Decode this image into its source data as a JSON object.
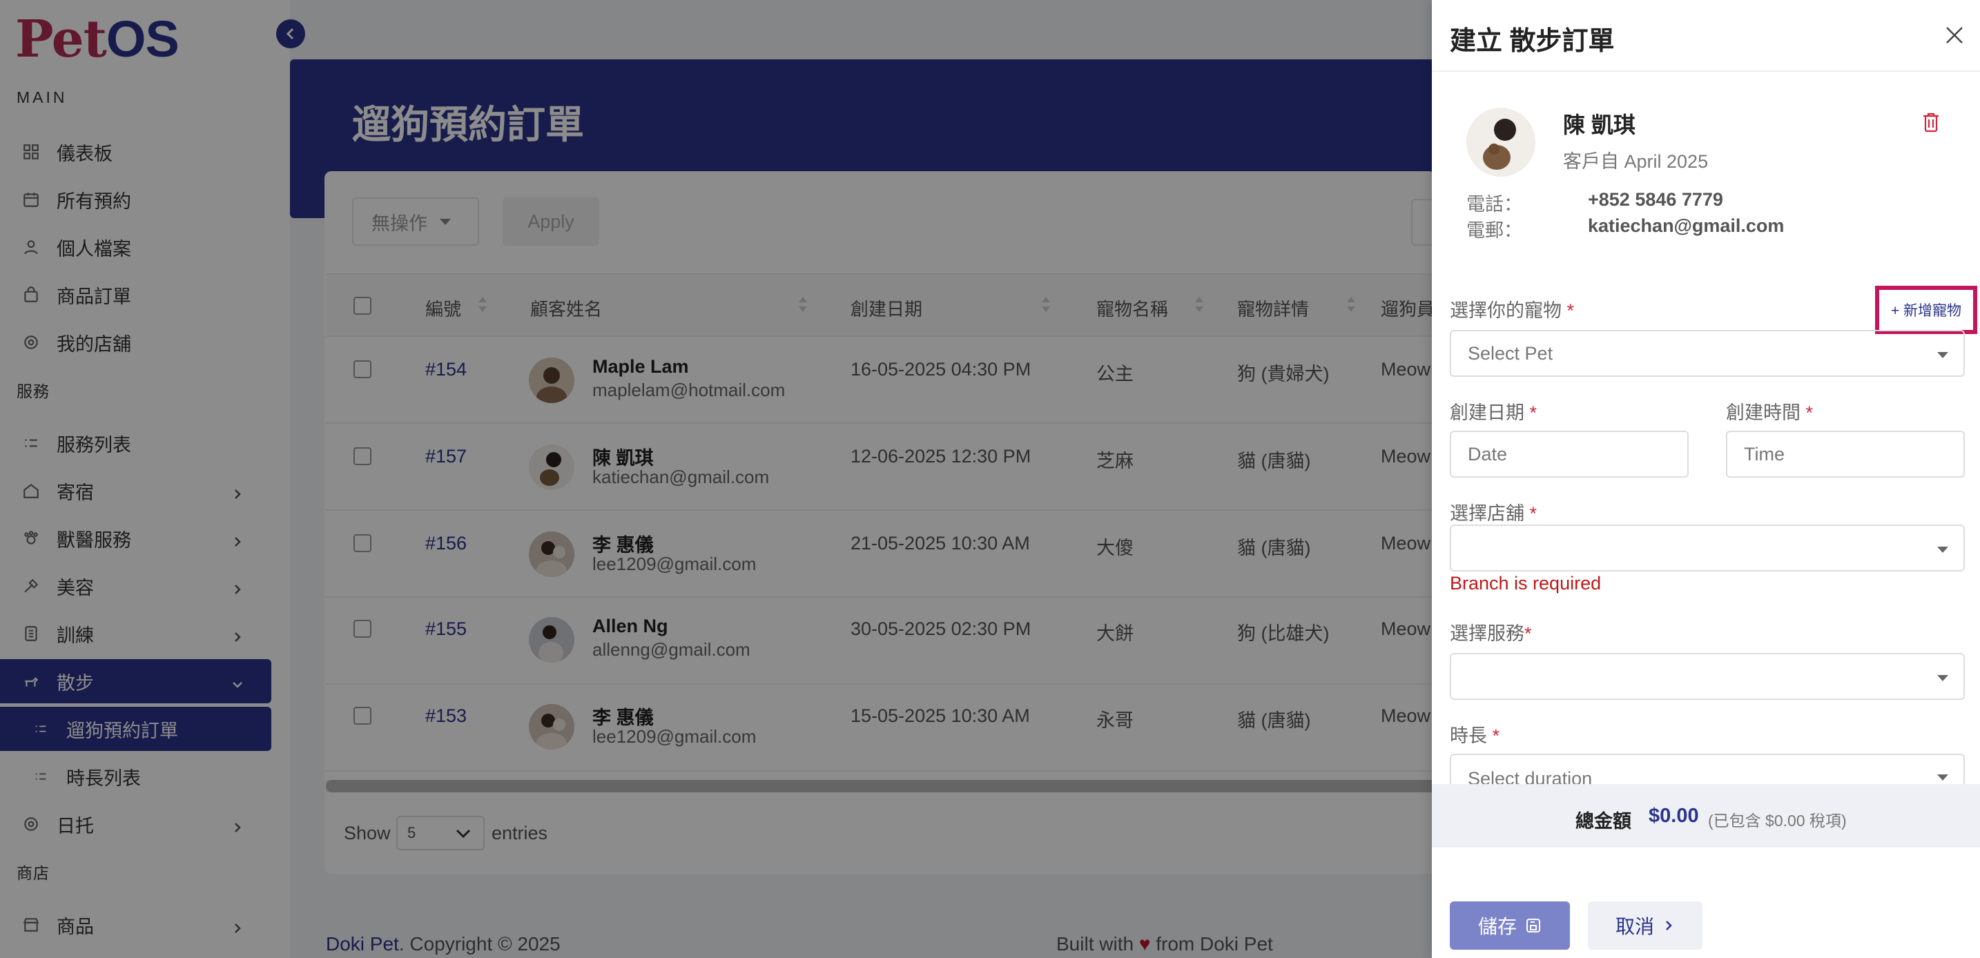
{
  "app": {
    "logo_pet": "Pet",
    "logo_os": "OS",
    "brand_color": "#2a348a",
    "accent_color": "#b32c52"
  },
  "sidebar": {
    "section_main": "MAIN",
    "section_services": "服務",
    "section_shop": "商店",
    "items": [
      {
        "label": "儀表板",
        "icon": "dashboard-icon"
      },
      {
        "label": "所有預約",
        "icon": "calendar-icon"
      },
      {
        "label": "個人檔案",
        "icon": "user-icon"
      },
      {
        "label": "商品訂單",
        "icon": "bag-icon"
      },
      {
        "label": "我的店舖",
        "icon": "shop-icon"
      },
      {
        "label": "服務列表",
        "icon": "list-icon"
      },
      {
        "label": "寄宿",
        "icon": "house-icon"
      },
      {
        "label": "獸醫服務",
        "icon": "vet-icon"
      },
      {
        "label": "美容",
        "icon": "grooming-icon"
      },
      {
        "label": "訓練",
        "icon": "training-icon"
      },
      {
        "label": "散步",
        "icon": "walk-icon"
      },
      {
        "label": "遛狗預約訂單",
        "icon": "list-icon"
      },
      {
        "label": "時長列表",
        "icon": "list-icon"
      },
      {
        "label": "日托",
        "icon": "daycare-icon"
      },
      {
        "label": "商品",
        "icon": "store-icon"
      }
    ]
  },
  "main": {
    "page_title": "遛狗預約訂單",
    "bulk_action": "無操作",
    "apply_label": "Apply",
    "columns": [
      "編號",
      "顧客姓名",
      "創建日期",
      "寵物名稱",
      "寵物詳情",
      "遛狗員"
    ],
    "rows": [
      {
        "id": "#154",
        "name": "Maple Lam",
        "email": "maplelam@hotmail.com",
        "date": "16-05-2025 04:30 PM",
        "pet": "公主",
        "detail": "狗 (貴婦犬)",
        "walker": "Meow"
      },
      {
        "id": "#157",
        "name": "陳 凱琪",
        "email": "katiechan@gmail.com",
        "date": "12-06-2025 12:30 PM",
        "pet": "芝麻",
        "detail": "貓 (唐貓)",
        "walker": "Meow"
      },
      {
        "id": "#156",
        "name": "李 惠儀",
        "email": "lee1209@gmail.com",
        "date": "21-05-2025 10:30 AM",
        "pet": "大傻",
        "detail": "貓 (唐貓)",
        "walker": "Meow"
      },
      {
        "id": "#155",
        "name": "Allen Ng",
        "email": "allenng@gmail.com",
        "date": "30-05-2025 02:30 PM",
        "pet": "大餅",
        "detail": "狗 (比雄犬)",
        "walker": "Meow"
      },
      {
        "id": "#153",
        "name": "李 惠儀",
        "email": "lee1209@gmail.com",
        "date": "15-05-2025 10:30 AM",
        "pet": "永哥",
        "detail": "貓 (唐貓)",
        "walker": "Meow"
      }
    ],
    "show_label": "Show",
    "entries_value": "5",
    "entries_label": "entries"
  },
  "footer": {
    "brand": "Doki Pet",
    "copyright": ". Copyright © 2025",
    "built_prefix": "Built with",
    "heart": "♥",
    "built_suffix": "from Doki Pet"
  },
  "drawer": {
    "title": "建立 散步訂單",
    "customer": {
      "name": "陳 凱琪",
      "since": "客戶自 April 2025",
      "phone_label": "電話：",
      "phone": "+852 5846 7779",
      "email_label": "電郵：",
      "email": "katiechan@gmail.com"
    },
    "fields": {
      "pet_label": "選擇你的寵物",
      "add_pet": "+ 新增寵物",
      "pet_placeholder": "Select Pet",
      "date_label": "創建日期",
      "date_placeholder": "Date",
      "time_label": "創建時間",
      "time_placeholder": "Time",
      "branch_label": "選擇店舖",
      "branch_value": "",
      "branch_error": "Branch is required",
      "service_label": "選擇服務",
      "service_value": "",
      "duration_label": "時長",
      "duration_placeholder": "Select duration",
      "required_mark": "*"
    },
    "total_label": "總金額",
    "total_amount": "$0.00",
    "total_tax": "(已包含 $0.00 稅項)",
    "save_label": "儲存",
    "cancel_label": "取消"
  }
}
